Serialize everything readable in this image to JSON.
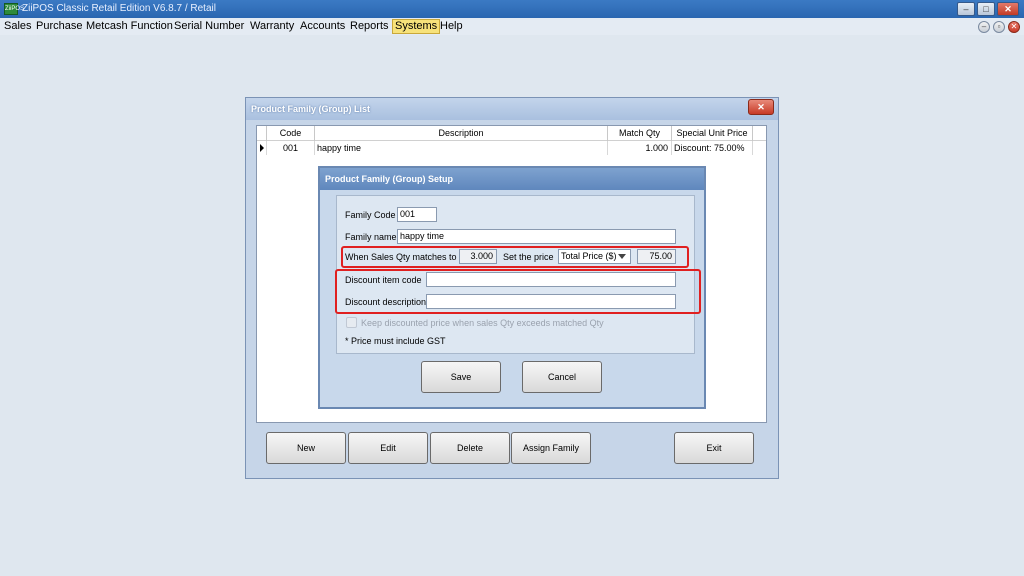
{
  "app": {
    "title": "ZiiPOS Classic Retail Edition V6.8.7 / Retail",
    "icon": "ziipos-app-icon",
    "controls": {
      "minimize": "–",
      "maximize": "□",
      "close": "✕"
    }
  },
  "menu": {
    "items": [
      "Sales",
      "Purchase",
      "Metcash Function",
      "Serial Number",
      "Warranty",
      "Accounts",
      "Reports",
      "Systems",
      "Help"
    ],
    "active": "Systems",
    "mdi": {
      "minimize": "–",
      "restore": "▫",
      "close": "✕"
    }
  },
  "list_window": {
    "title": "Product Family (Group) List",
    "close_label": "✕",
    "columns": [
      "Code",
      "Description",
      "Match Qty",
      "Special Unit Price"
    ],
    "rows": [
      {
        "code": "001",
        "description": "happy time",
        "match_qty": "1.000",
        "special_unit_price": "Discount: 75.00%"
      }
    ],
    "buttons": {
      "new": "New",
      "edit": "Edit",
      "delete": "Delete",
      "assign": "Assign Family",
      "exit": "Exit"
    }
  },
  "setup_dialog": {
    "title": "Product Family (Group) Setup",
    "family_code_label": "Family Code",
    "family_code_value": "001",
    "family_name_label": "Family name",
    "family_name_value": "happy time",
    "qty_label_prefix": "When Sales Qty matches  to",
    "qty_value": "3.000",
    "price_label": "Set the price",
    "price_mode": "Total Price ($)",
    "price_value": "75.00",
    "discount_code_label": "Discount item code",
    "discount_code_value": "",
    "discount_desc_label": "Discount description",
    "discount_desc_value": "",
    "keep_price_label": "Keep discounted price when sales Qty exceeds matched Qty",
    "gst_note": "* Price must include GST",
    "save_label": "Save",
    "cancel_label": "Cancel"
  },
  "colors": {
    "highlight_box": "#e02020",
    "menu_active": "#f7e27a",
    "close_red": "#c73a26"
  }
}
